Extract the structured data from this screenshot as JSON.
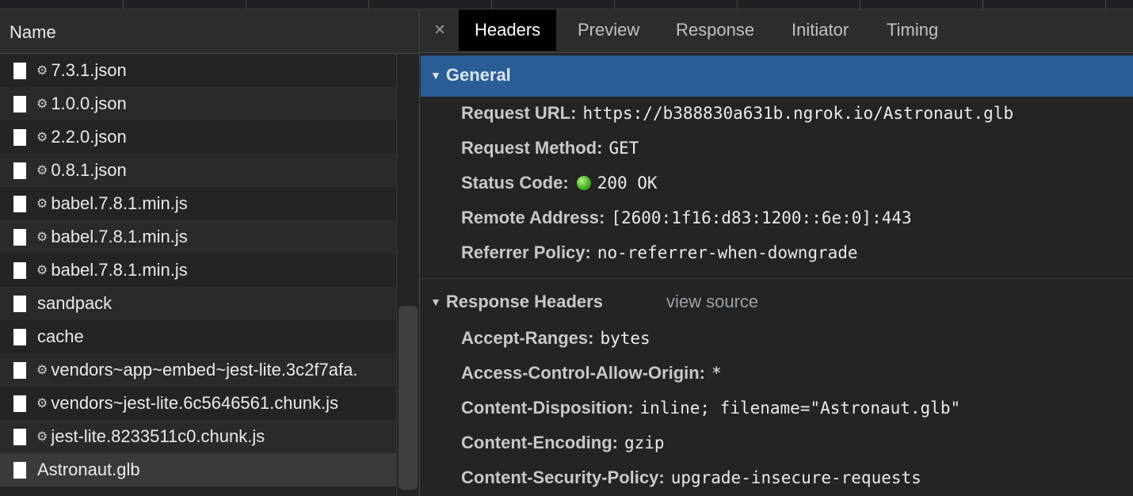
{
  "left_pane": {
    "column_header": "Name",
    "requests": [
      {
        "name": "7.3.1.json",
        "gear": true
      },
      {
        "name": "1.0.0.json",
        "gear": true
      },
      {
        "name": "2.2.0.json",
        "gear": true
      },
      {
        "name": "0.8.1.json",
        "gear": true
      },
      {
        "name": "babel.7.8.1.min.js",
        "gear": true
      },
      {
        "name": "babel.7.8.1.min.js",
        "gear": true
      },
      {
        "name": "babel.7.8.1.min.js",
        "gear": true
      },
      {
        "name": "sandpack",
        "gear": false
      },
      {
        "name": "cache",
        "gear": false
      },
      {
        "name": "vendors~app~embed~jest-lite.3c2f7afa.",
        "gear": true
      },
      {
        "name": "vendors~jest-lite.6c5646561.chunk.js",
        "gear": true
      },
      {
        "name": "jest-lite.8233511c0.chunk.js",
        "gear": true
      },
      {
        "name": "Astronaut.glb",
        "gear": false
      }
    ]
  },
  "tabs": {
    "close": "×",
    "items": [
      "Headers",
      "Preview",
      "Response",
      "Initiator",
      "Timing"
    ],
    "active": "Headers"
  },
  "general": {
    "title": "General",
    "fields": [
      {
        "key": "Request URL:",
        "value": "https://b388830a631b.ngrok.io/Astronaut.glb"
      },
      {
        "key": "Request Method:",
        "value": "GET"
      },
      {
        "key": "Status Code:",
        "value": "200 OK"
      },
      {
        "key": "Remote Address:",
        "value": "[2600:1f16:d83:1200::6e:0]:443"
      },
      {
        "key": "Referrer Policy:",
        "value": "no-referrer-when-downgrade"
      }
    ]
  },
  "response_headers": {
    "title": "Response Headers",
    "view_source": "view source",
    "fields": [
      {
        "key": "Accept-Ranges:",
        "value": "bytes"
      },
      {
        "key": "Access-Control-Allow-Origin:",
        "value": "*"
      },
      {
        "key": "Content-Disposition:",
        "value": "inline; filename=\"Astronaut.glb\""
      },
      {
        "key": "Content-Encoding:",
        "value": "gzip"
      },
      {
        "key": "Content-Security-Policy:",
        "value": "upgrade-insecure-requests"
      }
    ]
  },
  "colors": {
    "section_highlight": "#2b5d96",
    "status_ok": "#3fae1f"
  },
  "icons": {
    "expand": "triangle-down-icon",
    "gear": "gear-icon",
    "file": "file-icon",
    "close": "close-icon"
  }
}
